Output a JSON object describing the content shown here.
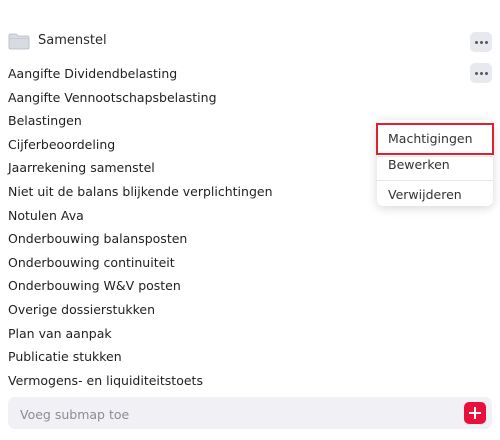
{
  "folder": {
    "title": "Samenstel",
    "folder_icon": "folder-icon",
    "more_icon": "more-horizontal-icon"
  },
  "items": [
    {
      "label": "Aangifte Dividendbelasting"
    },
    {
      "label": "Aangifte Vennootschapsbelasting"
    },
    {
      "label": "Belastingen"
    },
    {
      "label": "Cijferbeoordeling"
    },
    {
      "label": "Jaarrekening samenstel"
    },
    {
      "label": "Niet uit de balans blijkende verplichtingen"
    },
    {
      "label": "Notulen Ava"
    },
    {
      "label": "Onderbouwing balansposten"
    },
    {
      "label": "Onderbouwing continuiteit"
    },
    {
      "label": "Onderbouwing W&V posten"
    },
    {
      "label": "Overige dossierstukken"
    },
    {
      "label": "Plan van aanpak"
    },
    {
      "label": "Publicatie stukken"
    },
    {
      "label": "Vermogens- en liquiditeitstoets"
    }
  ],
  "context_menu": {
    "items": [
      {
        "label": "Machtigingen",
        "highlighted": true
      },
      {
        "label": "Bewerken"
      },
      {
        "label": "Verwijderen"
      }
    ],
    "highlight_color": "#e0202e"
  },
  "add_subfolder": {
    "placeholder": "Voeg submap toe",
    "value": "",
    "button_icon": "plus-icon",
    "button_color": "#e8113c"
  }
}
